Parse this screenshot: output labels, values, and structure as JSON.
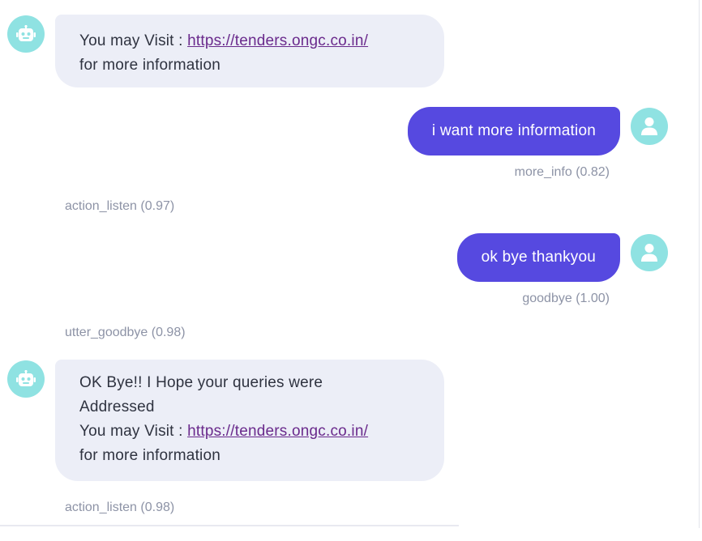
{
  "colors": {
    "avatar_bg": "#8fe2e2",
    "bot_bubble_bg": "#eceef7",
    "user_bubble_bg": "#5649e0",
    "link": "#6a2a8c",
    "meta_text": "#8d93a6"
  },
  "icons": {
    "bot_avatar": "robot-icon",
    "user_avatar": "user-icon"
  },
  "messages": [
    {
      "sender": "bot",
      "visit_prefix": "You may Visit : ",
      "link": "https://tenders.ongc.co.in/",
      "suffix": "for more information"
    },
    {
      "sender": "user",
      "text": "i want more information",
      "intent": "more_info (0.82)"
    },
    {
      "action": "action_listen (0.97)"
    },
    {
      "sender": "user",
      "text": "ok bye thankyou",
      "intent": "goodbye (1.00)"
    },
    {
      "action": "utter_goodbye (0.98)"
    },
    {
      "sender": "bot",
      "line1": "OK Bye!! I Hope your queries were",
      "line2": "Addressed",
      "visit_prefix": "You may Visit : ",
      "link": "https://tenders.ongc.co.in/",
      "suffix": "for more information"
    },
    {
      "action": "action_listen (0.98)"
    }
  ]
}
